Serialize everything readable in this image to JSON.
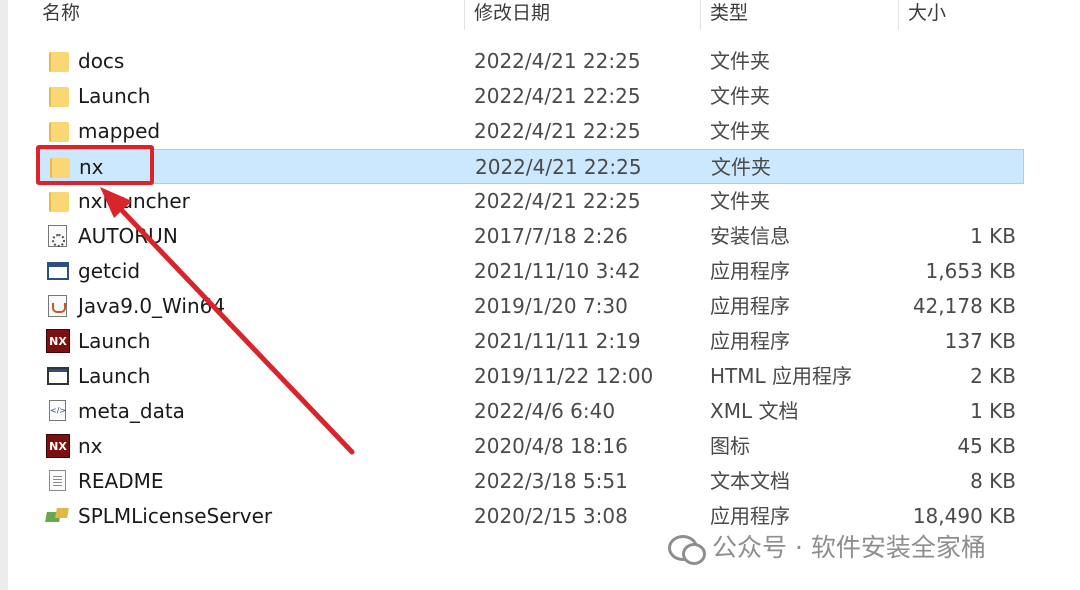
{
  "columns": {
    "name": "名称",
    "modified": "修改日期",
    "type": "类型",
    "size": "大小"
  },
  "files": [
    {
      "name": "docs",
      "modified": "2022/4/21 22:25",
      "type": "文件夹",
      "size": "",
      "icon": "folder-icon"
    },
    {
      "name": "Launch",
      "modified": "2022/4/21 22:25",
      "type": "文件夹",
      "size": "",
      "icon": "folder-icon"
    },
    {
      "name": "mapped",
      "modified": "2022/4/21 22:25",
      "type": "文件夹",
      "size": "",
      "icon": "folder-icon"
    },
    {
      "name": "nx",
      "modified": "2022/4/21 22:25",
      "type": "文件夹",
      "size": "",
      "icon": "folder-icon",
      "selected": true
    },
    {
      "name": "nxlauncher",
      "modified": "2022/4/21 22:25",
      "type": "文件夹",
      "size": "",
      "icon": "folder-icon"
    },
    {
      "name": "AUTORUN",
      "modified": "2017/7/18 2:26",
      "type": "安装信息",
      "size": "1 KB",
      "icon": "setup-info-icon"
    },
    {
      "name": "getcid",
      "modified": "2021/11/10 3:42",
      "type": "应用程序",
      "size": "1,653 KB",
      "icon": "app-icon"
    },
    {
      "name": "Java9.0_Win64",
      "modified": "2019/1/20 7:30",
      "type": "应用程序",
      "size": "42,178 KB",
      "icon": "java-icon"
    },
    {
      "name": "Launch",
      "modified": "2021/11/11 2:19",
      "type": "应用程序",
      "size": "137 KB",
      "icon": "nx-app-icon"
    },
    {
      "name": "Launch",
      "modified": "2019/11/22 12:00",
      "type": "HTML 应用程序",
      "size": "2 KB",
      "icon": "hta-icon"
    },
    {
      "name": "meta_data",
      "modified": "2022/4/6 6:40",
      "type": "XML 文档",
      "size": "1 KB",
      "icon": "xml-icon"
    },
    {
      "name": "nx",
      "modified": "2020/4/8 18:16",
      "type": "图标",
      "size": "45 KB",
      "icon": "nx-icon-file-icon"
    },
    {
      "name": "README",
      "modified": "2022/3/18 5:51",
      "type": "文本文档",
      "size": "8 KB",
      "icon": "text-file-icon"
    },
    {
      "name": "SPLMLicenseServer",
      "modified": "2020/2/15 3:08",
      "type": "应用程序",
      "size": "18,490 KB",
      "icon": "server-app-icon"
    }
  ],
  "watermark": {
    "text": "公众号 · 软件安装全家桶",
    "icon": "wechat-icon"
  },
  "colors": {
    "selection_bg": "#cce8ff",
    "selection_border": "#99d1ff",
    "highlight_red": "#d9242b",
    "folder_yellow": "#f8d774"
  }
}
